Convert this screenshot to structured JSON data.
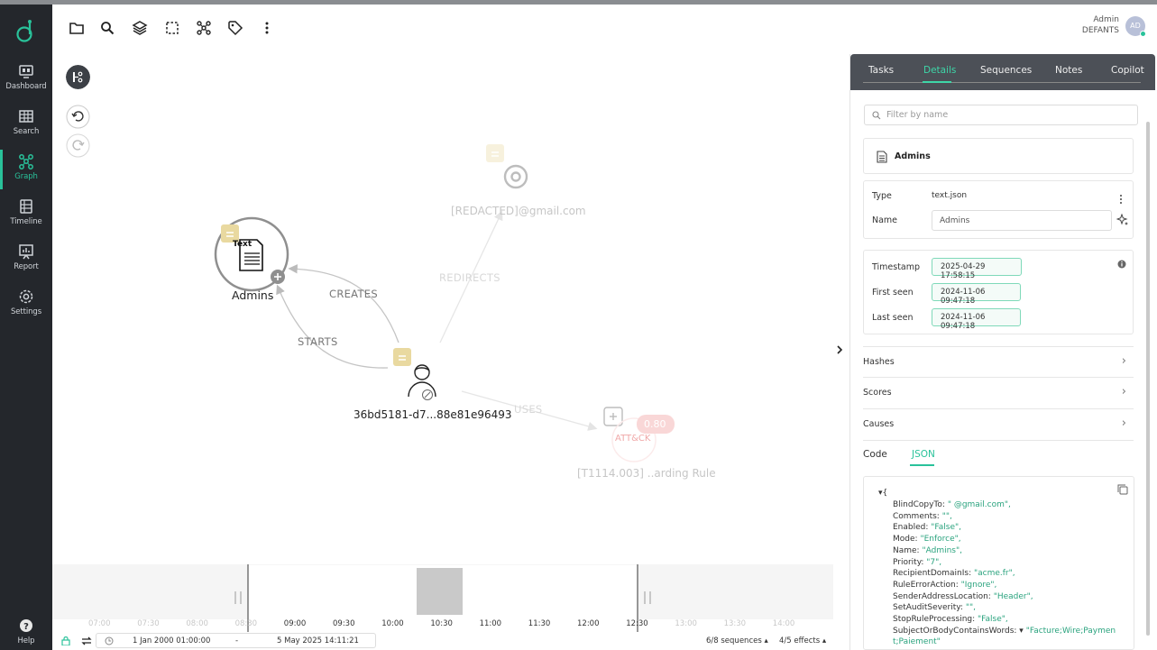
{
  "sidebar": {
    "items": [
      {
        "label": "Dashboard",
        "icon": "monitor-icon"
      },
      {
        "label": "Search",
        "icon": "grid-icon"
      },
      {
        "label": "Graph",
        "icon": "graph-icon",
        "active": true
      },
      {
        "label": "Timeline",
        "icon": "timeline-icon"
      },
      {
        "label": "Report",
        "icon": "report-icon"
      },
      {
        "label": "Settings",
        "icon": "gear-icon"
      }
    ],
    "help_label": "Help"
  },
  "user": {
    "name": "Admin",
    "org": "DEFANTS",
    "initials": "AD"
  },
  "graph": {
    "nodes": {
      "admins": {
        "type_label": "Text",
        "label": "Admins"
      },
      "user": {
        "label": "36bd5181-d7...88e81e96493"
      },
      "email": {
        "label": "[REDACTED]@gmail.com"
      },
      "rule": {
        "label": "[T1114.003] ..arding Rule",
        "badge": "ATT&CK",
        "score": "0.80"
      }
    },
    "edges": {
      "creates": "CREATES",
      "starts": "STARTS",
      "redirects": "REDIRECTS",
      "uses": "USES"
    }
  },
  "timeline": {
    "ticks": [
      "07:00",
      "07:30",
      "08:00",
      "08:30",
      "09:00",
      "09:30",
      "10:00",
      "10:30",
      "11:00",
      "11:30",
      "12:00",
      "12:30",
      "13:00",
      "13:30",
      "14:00"
    ],
    "start": "1 Jan 2000 01:00:00",
    "separator": "-",
    "end": "5 May 2025 14:11:21",
    "sequences": "6/8 sequences",
    "effects": "4/5 effects"
  },
  "panel": {
    "tabs": [
      "Tasks",
      "Details",
      "Sequences",
      "Notes",
      "Copilot"
    ],
    "active_tab": "Details",
    "filter_placeholder": "Filter by name",
    "object_title": "Admins",
    "type_label": "Type",
    "type_value": "text.json",
    "name_label": "Name",
    "name_value": "Admins",
    "timestamp_label": "Timestamp",
    "timestamp_value": "2025-04-29 17:58:15",
    "first_seen_label": "First seen",
    "first_seen_value": "2024-11-06 09:47:18",
    "last_seen_label": "Last seen",
    "last_seen_value": "2024-11-06 09:47:18",
    "sections": [
      "Hashes",
      "Scores",
      "Causes"
    ],
    "code_tabs": [
      "Code",
      "JSON"
    ],
    "json_open": "▾{",
    "json_lines": [
      {
        "key": "BlindCopyTo:",
        "value": "\"                    @gmail.com\","
      },
      {
        "key": "Comments:",
        "value": "\"\","
      },
      {
        "key": "Enabled:",
        "value": "\"False\","
      },
      {
        "key": "Mode:",
        "value": "\"Enforce\","
      },
      {
        "key": "Name:",
        "value": "\"Admins\","
      },
      {
        "key": "Priority:",
        "value": "\"7\","
      },
      {
        "key": "RecipientDomainIs:",
        "value": "\"acme.fr\","
      },
      {
        "key": "RuleErrorAction:",
        "value": "\"Ignore\","
      },
      {
        "key": "SenderAddressLocation:",
        "value": "\"Header\","
      },
      {
        "key": "SetAuditSeverity:",
        "value": "\"\","
      },
      {
        "key": "StopRuleProcessing:",
        "value": "\"False\","
      },
      {
        "key": "SubjectOrBodyContainsWords: ▾",
        "value": "\"Facture;Wire;Paymen"
      },
      {
        "key": "",
        "value": "t;Paiement\""
      }
    ]
  },
  "colors": {
    "accent": "#29c29a",
    "sidebar": "#24272c",
    "panel_header": "#4c5057",
    "tag": "#e9d9a0",
    "score": "#f08f8f"
  }
}
